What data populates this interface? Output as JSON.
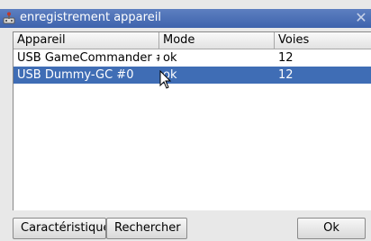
{
  "window": {
    "title": "enregistrement appareil",
    "close_glyph": "✕"
  },
  "table": {
    "headers": [
      "Appareil",
      "Mode",
      "Voies"
    ],
    "rows": [
      {
        "device": "USB GameCommander #",
        "mode": "ok",
        "channels": "12",
        "selected": false
      },
      {
        "device": "USB Dummy-GC #0",
        "mode": "ok",
        "channels": "12",
        "selected": true
      }
    ],
    "selection_color": "#3f6db5"
  },
  "buttons": {
    "features_label": "Caractéristique",
    "search_label": "Rechercher",
    "ok_label": "Ok"
  },
  "icons": {
    "app": "joystick-icon",
    "cursor": "mouse-pointer-icon"
  }
}
